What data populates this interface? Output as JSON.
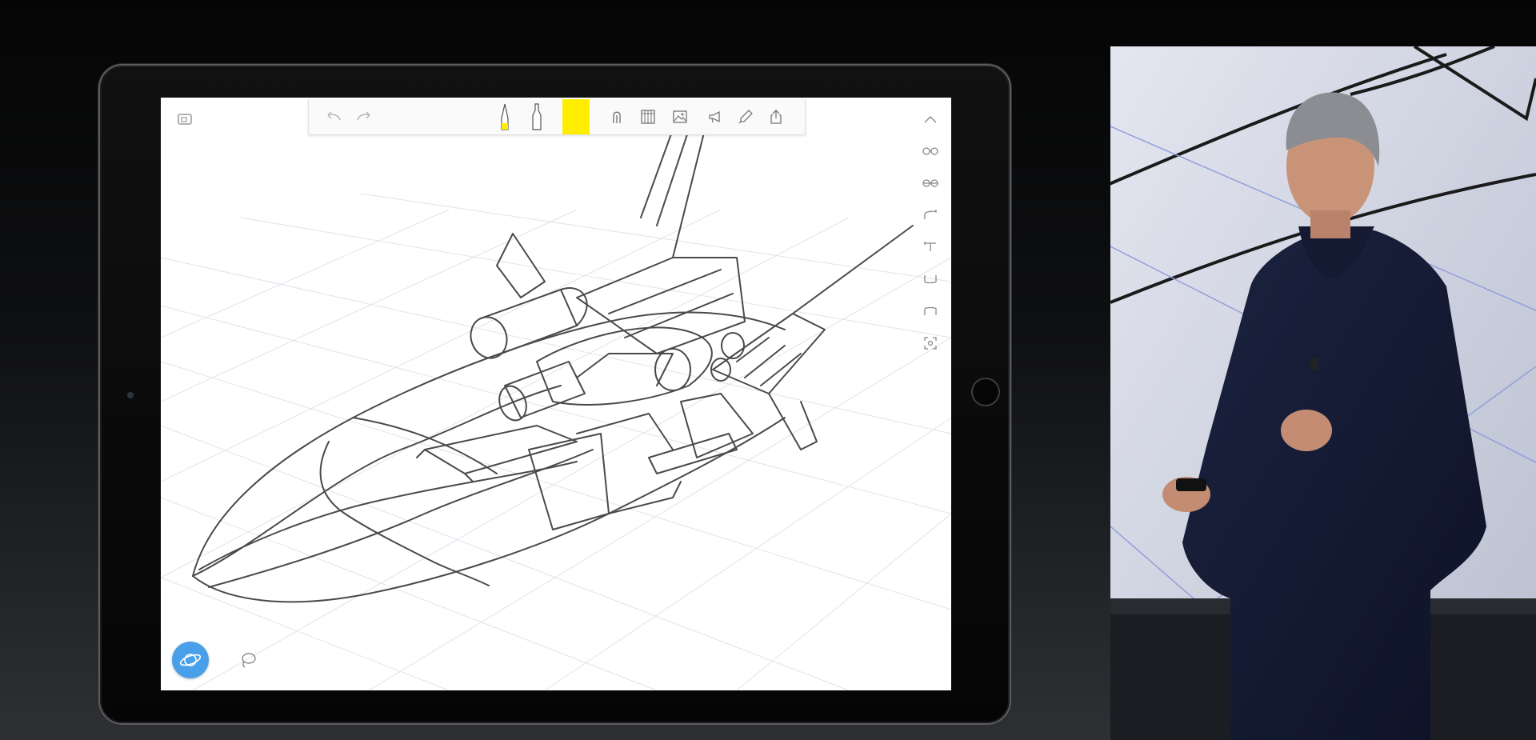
{
  "app": {
    "toolbar": {
      "undo_icon": "undo-arrow-icon",
      "redo_icon": "redo-arrow-icon",
      "tools": [
        "pencil-icon",
        "marker-icon"
      ],
      "active_color": "#ffee00",
      "tools_right": [
        "rail-icon",
        "grid-icon",
        "image-icon",
        "megaphone-icon",
        "pen-nib-icon",
        "share-icon"
      ]
    },
    "side_toolbar": [
      "chevron-up-icon",
      "link-both-icon",
      "link-detach-icon",
      "curve-start-icon",
      "curve-end-icon",
      "bracket-bottom-icon",
      "bracket-top-icon",
      "frame-select-icon"
    ],
    "bottom": {
      "orbit_icon": "orbit-icon",
      "orbit_color": "#4aa0e8",
      "lasso_icon": "lasso-icon"
    }
  }
}
